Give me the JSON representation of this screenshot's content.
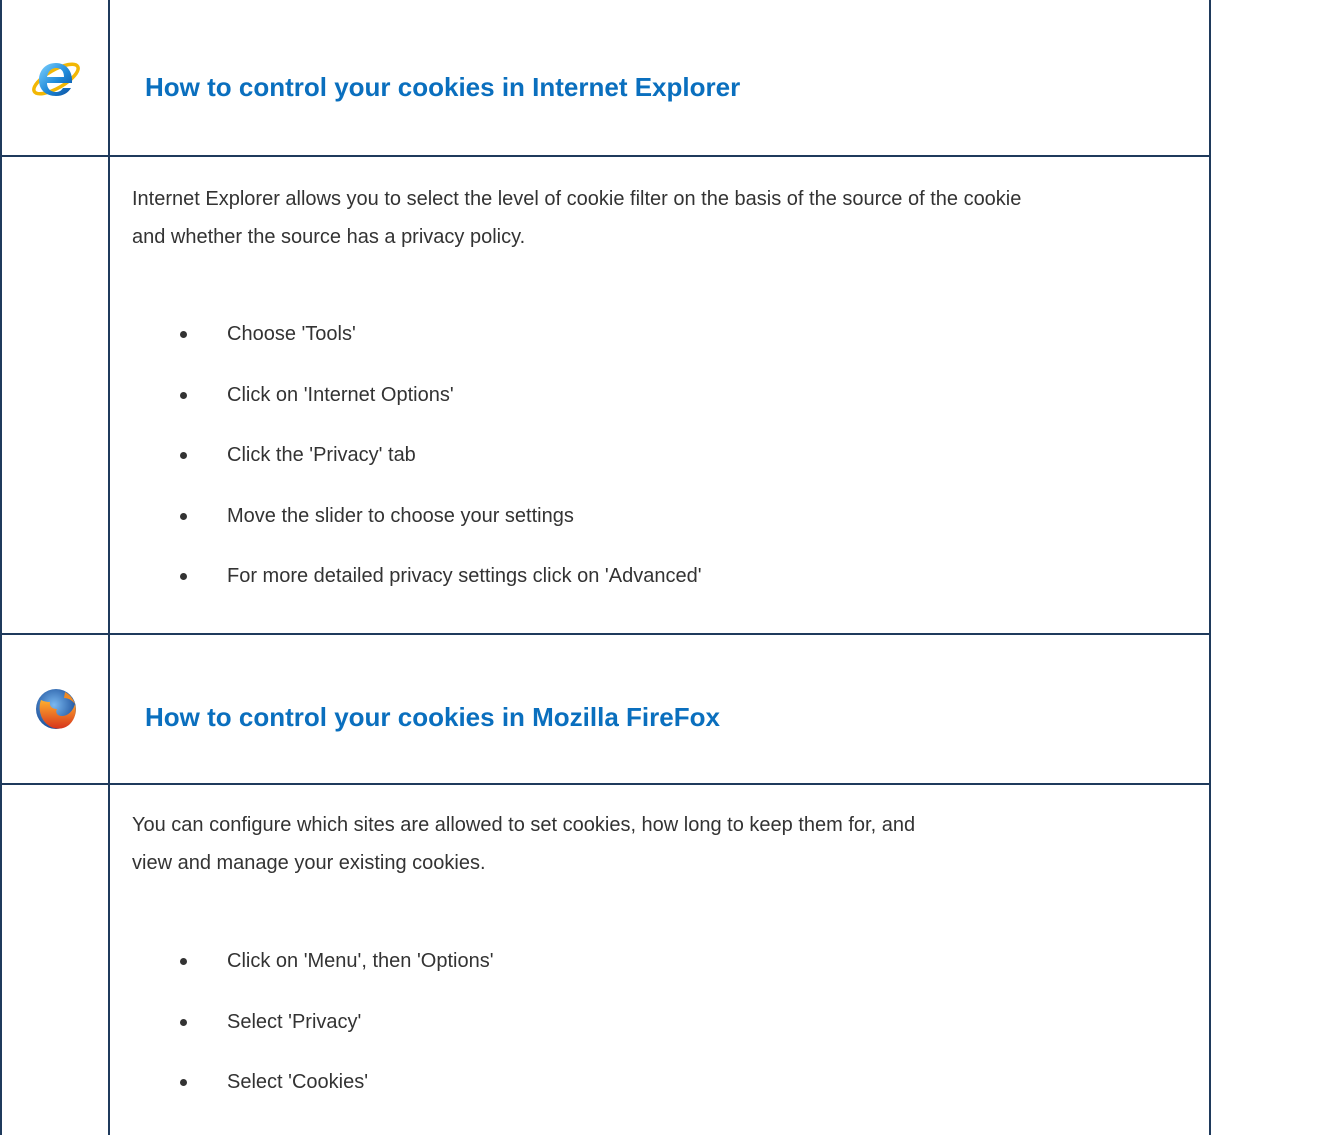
{
  "sections": [
    {
      "browser_icon": "internet-explorer-icon",
      "title": "How to control your cookies in Internet Explorer",
      "intro_lines": [
        "Internet Explorer allows you to select the level of cookie filter on the basis of the source of the cookie",
        "and whether the source has a privacy policy."
      ],
      "steps": [
        "Choose 'Tools'",
        "Click on 'Internet Options'",
        "Click the 'Privacy' tab",
        "Move the slider to choose your settings",
        "For more detailed privacy settings click on 'Advanced'"
      ]
    },
    {
      "browser_icon": "firefox-icon",
      "title": "How to control your cookies in Mozilla FireFox",
      "intro_lines": [
        "You can configure which sites are allowed to set cookies, how long to keep them for, and",
        "view and manage your existing cookies."
      ],
      "steps": [
        "Click on 'Menu', then 'Options'",
        "Select 'Privacy'",
        "Select 'Cookies'"
      ]
    }
  ],
  "colors": {
    "heading": "#0a6fbe",
    "border": "#1f3a5c",
    "text": "#333333"
  }
}
